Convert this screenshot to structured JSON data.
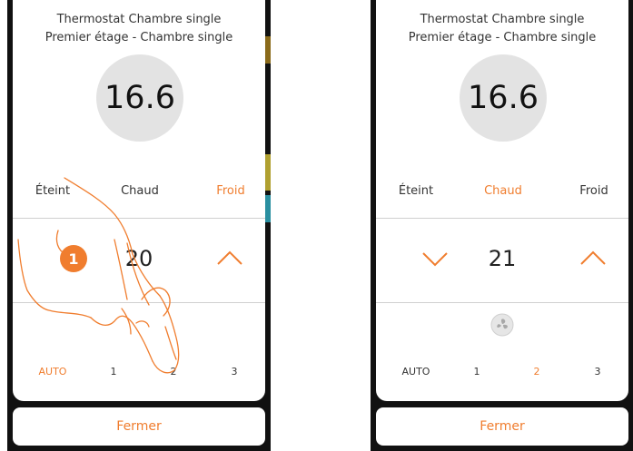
{
  "colors": {
    "accent": "#f07d2e",
    "dark_frame": "#111111",
    "circle": "#e3e3e3"
  },
  "screens": [
    {
      "title_line1": "Thermostat Chambre single",
      "title_line2": "Premier étage - Chambre single",
      "temperature": "16.6",
      "modes": {
        "off": "Éteint",
        "heat": "Chaud",
        "cool": "Froid",
        "active": "Froid"
      },
      "setpoint": "20",
      "speeds": {
        "auto": "AUTO",
        "s1": "1",
        "s2": "2",
        "s3": "3",
        "active": "AUTO"
      },
      "close_label": "Fermer",
      "step_badge": "1",
      "icons": {
        "up": "chevron-up-icon",
        "hand": "pointing-hand-icon"
      }
    },
    {
      "title_line1": "Thermostat Chambre single",
      "title_line2": "Premier étage - Chambre single",
      "temperature": "16.6",
      "modes": {
        "off": "Éteint",
        "heat": "Chaud",
        "cool": "Froid",
        "active": "Chaud"
      },
      "setpoint": "21",
      "speeds": {
        "auto": "AUTO",
        "s1": "1",
        "s2": "2",
        "s3": "3",
        "active": "2"
      },
      "close_label": "Fermer",
      "icons": {
        "down": "chevron-down-icon",
        "up": "chevron-up-icon",
        "fan": "fan-icon"
      }
    }
  ]
}
